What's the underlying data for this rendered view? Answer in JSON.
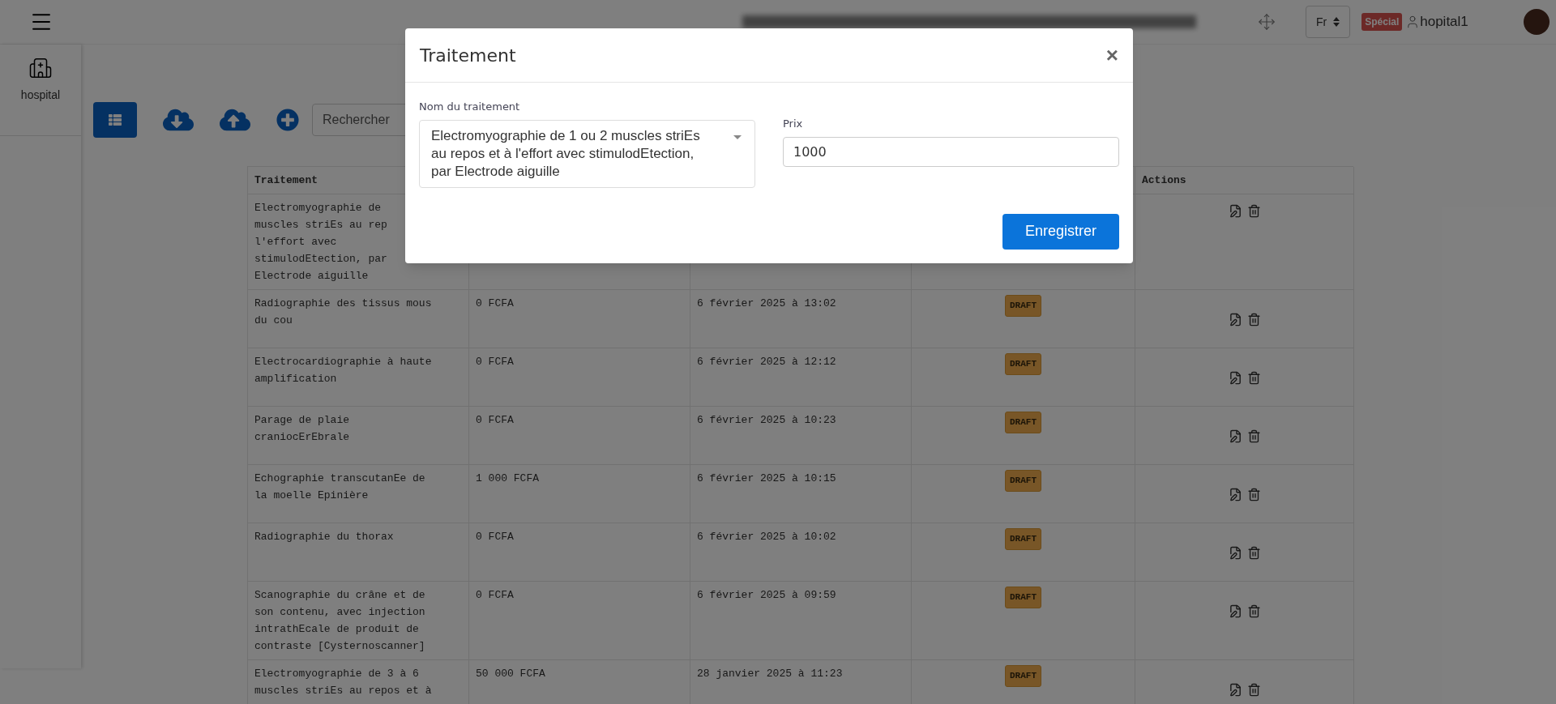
{
  "header": {
    "brand_label": "hospital",
    "language": "Fr",
    "badge": "Spécial",
    "username": "hopital1"
  },
  "toolbar": {
    "search_placeholder": "Rechercher"
  },
  "table": {
    "columns": [
      "Traitement",
      "Actions"
    ],
    "rows": [
      {
        "lines": [
          "Electromyographie de",
          "muscles striEs au rep",
          "l'effort avec",
          "stimulodEtection, par",
          "Electrode aiguille"
        ]
      },
      {
        "lines": [
          "Radiographie des tissus mous",
          "du cou"
        ],
        "price": "0 FCFA",
        "date": "6 février 2025 à 13:02",
        "status": "DRAFT"
      },
      {
        "lines": [
          "Electrocardiographie à haute",
          "amplification"
        ],
        "price": "0 FCFA",
        "date": "6 février 2025 à 12:12",
        "status": "DRAFT"
      },
      {
        "lines": [
          "Parage de plaie",
          "craniocErEbrale"
        ],
        "price": "0 FCFA",
        "date": "6 février 2025 à 10:23",
        "status": "DRAFT"
      },
      {
        "lines": [
          "Echographie transcutanEe de",
          "la moelle Epinière"
        ],
        "price": "1 000 FCFA",
        "date": "6 février 2025 à 10:15",
        "status": "DRAFT"
      },
      {
        "lines": [
          "Radiographie du thorax"
        ],
        "price": "0 FCFA",
        "date": "6 février 2025 à 10:02",
        "status": "DRAFT"
      },
      {
        "lines": [
          "Scanographie du crâne et de",
          "son contenu, avec injection",
          "intrathEcale de produit de",
          "contraste [Cysternoscanner]"
        ],
        "price": "0 FCFA",
        "date": "6 février 2025 à 09:59",
        "status": "DRAFT"
      },
      {
        "lines": [
          "Electromyographie de 3 à 6",
          "muscles striEs au repos et à"
        ],
        "price": "50 000 FCFA",
        "date": "28 janvier 2025 à 11:23",
        "status": "DRAFT"
      }
    ]
  },
  "modal": {
    "title": "Traitement",
    "close_label": "×",
    "name_label": "Nom du traitement",
    "name_value": "Electromyographie de 1 ou 2 muscles striEs au repos et à l'effort avec stimulodEtection, par Electrode aiguille",
    "price_label": "Prix",
    "price_value": "1000",
    "submit_label": "Enregistrer"
  }
}
